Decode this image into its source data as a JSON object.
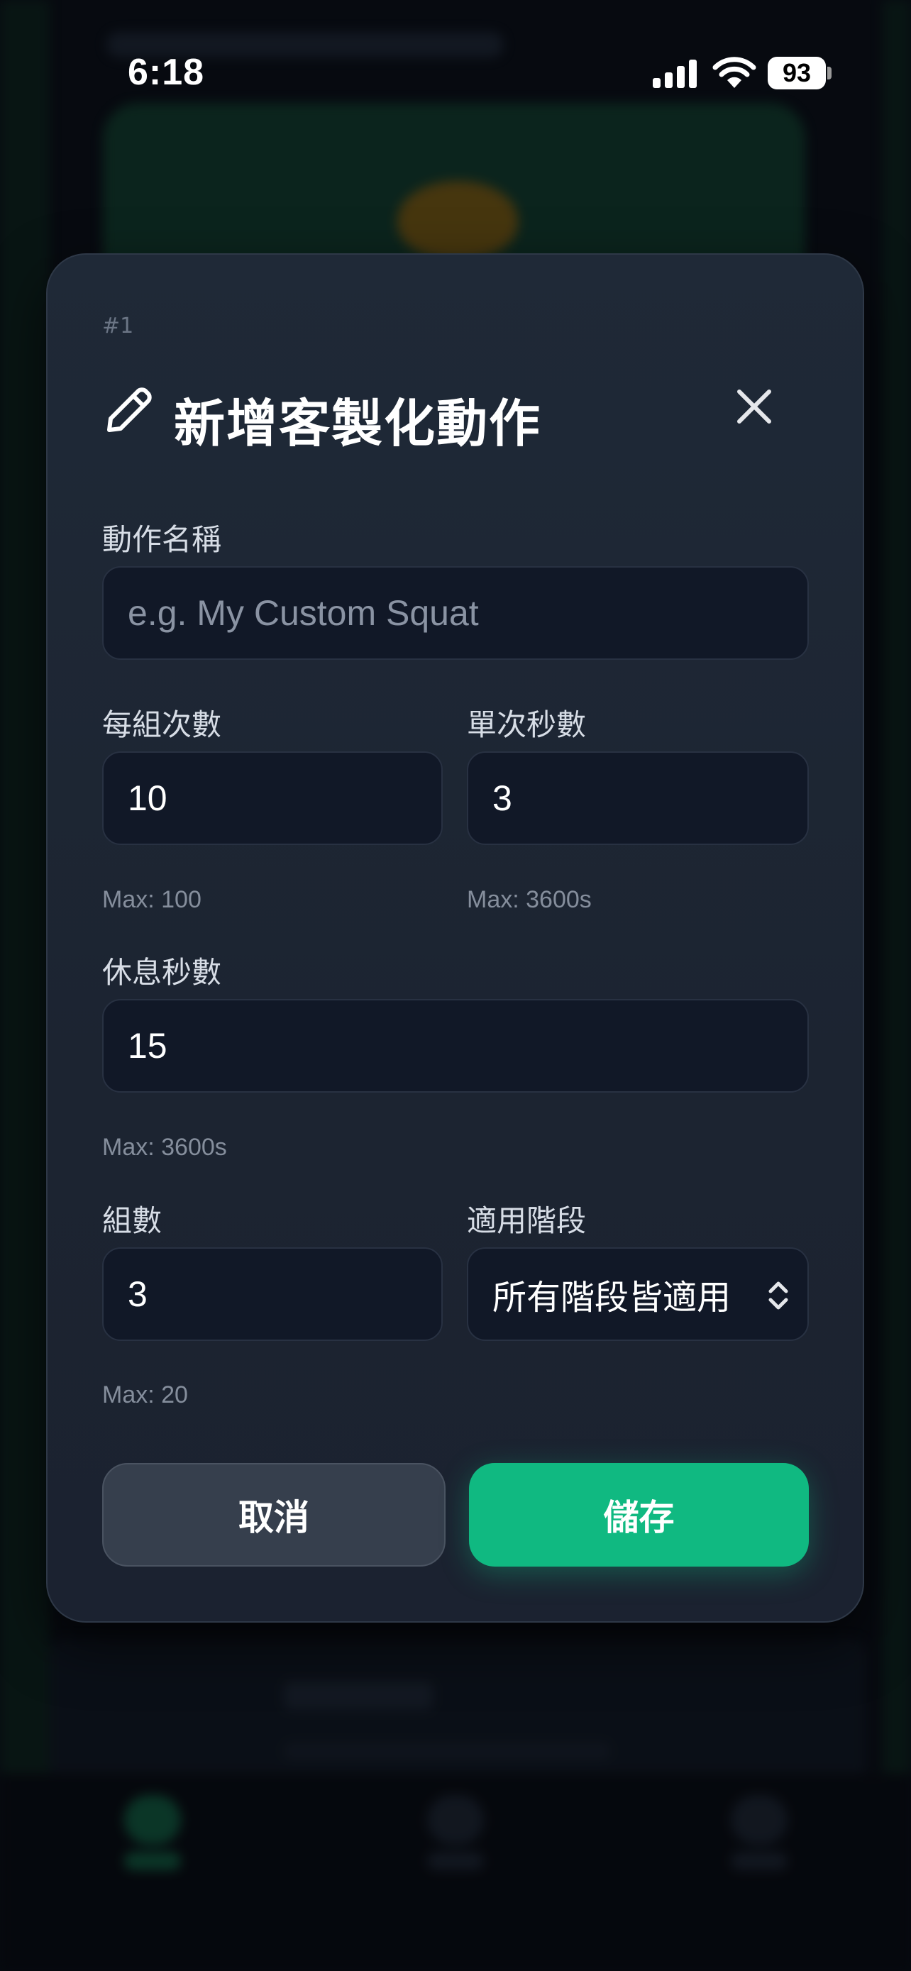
{
  "status_bar": {
    "time": "6:18",
    "battery": "93"
  },
  "modal": {
    "index": "#1",
    "title": "新增客製化動作",
    "icons": {
      "title_icon": "pencil-edit-icon",
      "close_icon": "close-icon",
      "select_icon": "chevron-up-down-icon"
    },
    "name_field": {
      "label": "動作名稱",
      "placeholder": "e.g. My Custom Squat",
      "value": ""
    },
    "reps_field": {
      "label": "每組次數",
      "value": "10",
      "hint": "Max: 100"
    },
    "seconds_field": {
      "label": "單次秒數",
      "value": "3",
      "hint": "Max: 3600s"
    },
    "rest_field": {
      "label": "休息秒數",
      "value": "15",
      "hint": "Max: 3600s"
    },
    "sets_field": {
      "label": "組數",
      "value": "3",
      "hint": "Max: 20"
    },
    "stage_field": {
      "label": "適用階段",
      "selected": "所有階段皆適用"
    },
    "cancel_label": "取消",
    "save_label": "儲存"
  },
  "colors": {
    "accent": "#10b981",
    "modal_bg": "#1f2937",
    "input_bg": "#111827",
    "cancel_bg": "#363f4d"
  }
}
